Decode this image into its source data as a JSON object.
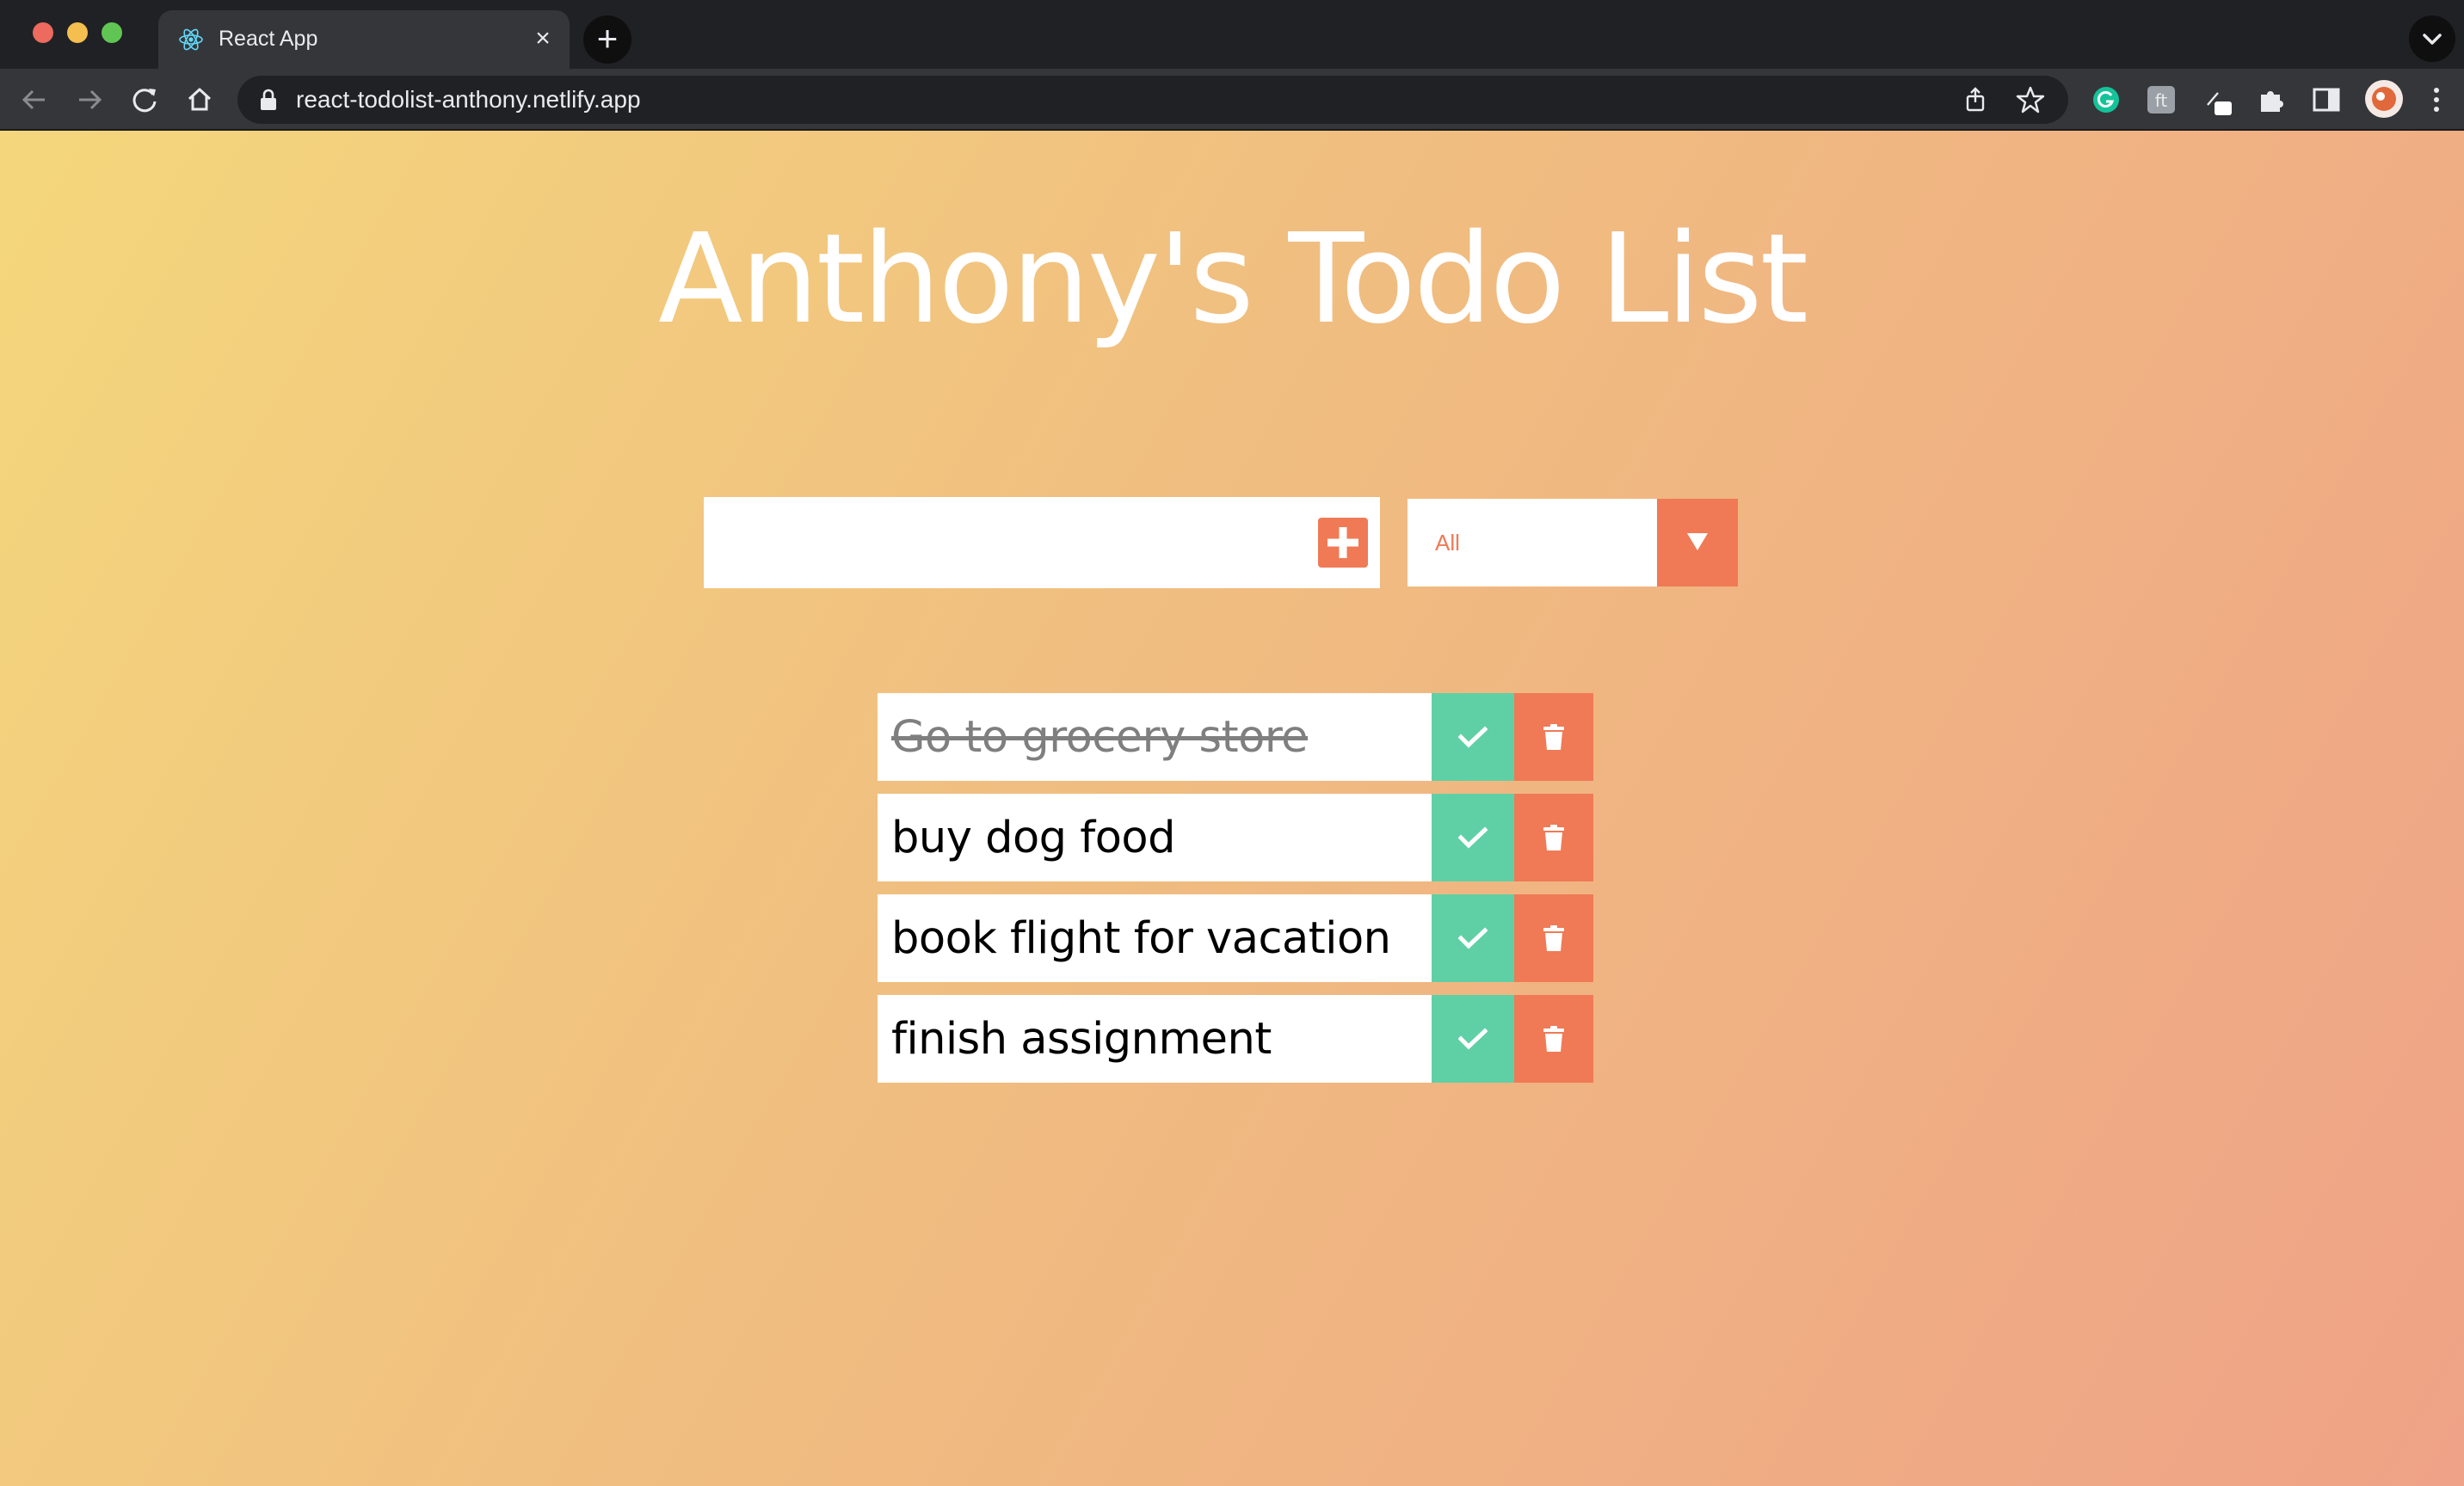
{
  "browser": {
    "tab": {
      "title": "React App"
    },
    "address": {
      "url": "react-todolist-anthony.netlify.app"
    },
    "colors": {
      "chrome_dark": "#202124",
      "chrome_toolbar": "#35363a"
    }
  },
  "app": {
    "title": "Anthony's Todo List",
    "input": {
      "value": "",
      "placeholder": ""
    },
    "filter": {
      "selected": "All"
    },
    "todos": [
      {
        "text": "Go to grocery store",
        "completed": true
      },
      {
        "text": "buy dog food",
        "completed": false
      },
      {
        "text": "book flight for vacation",
        "completed": false
      },
      {
        "text": "finish assignment",
        "completed": false
      }
    ],
    "colors": {
      "accent": "#ef7a55",
      "complete": "#5fd0a5",
      "gradient_start": "#f4d77c",
      "gradient_end": "#efa287"
    }
  }
}
